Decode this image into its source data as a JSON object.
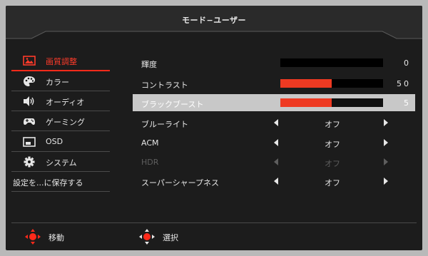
{
  "header": {
    "title": "モード−ユーザー"
  },
  "sidebar": {
    "items": [
      {
        "label": "画質調整",
        "icon": "picture-icon",
        "active": true
      },
      {
        "label": "カラー",
        "icon": "palette-icon"
      },
      {
        "label": "オーディオ",
        "icon": "speaker-icon"
      },
      {
        "label": "ゲーミング",
        "icon": "gamepad-icon"
      },
      {
        "label": "OSD",
        "icon": "osd-window-icon"
      },
      {
        "label": "システム",
        "icon": "gear-icon"
      }
    ],
    "save_label": "設定を...に保存する"
  },
  "settings": {
    "brightness": {
      "label": "輝度",
      "value": "0",
      "level": 0
    },
    "contrast": {
      "label": "コントラスト",
      "value": "50",
      "level": 0.5
    },
    "black_boost": {
      "label": "ブラックブースト",
      "value": "5",
      "level": 0.5
    },
    "blue_light": {
      "label": "ブルーライト",
      "value": "オフ"
    },
    "acm": {
      "label": "ACM",
      "value": "オフ"
    },
    "hdr": {
      "label": "HDR",
      "value": "オフ",
      "disabled": true
    },
    "super_sharpness": {
      "label": "スーパーシャープネス",
      "value": "オフ"
    }
  },
  "footer": {
    "move_label": "移動",
    "select_label": "選択"
  },
  "colors": {
    "accent": "#ff2a1a",
    "bar_fill": "#ee3a22",
    "panel": "#1c1c1c",
    "selected_row": "#c8c8c8"
  }
}
